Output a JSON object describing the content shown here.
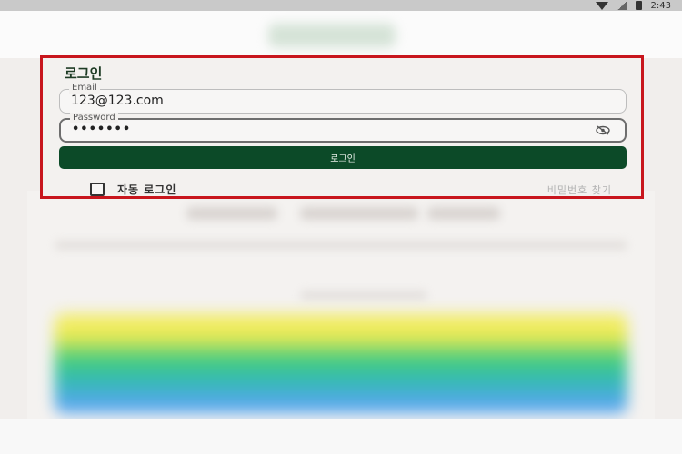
{
  "status_bar": {
    "time": "2:43",
    "icons": [
      "wifi-icon",
      "signal-icon",
      "battery-icon"
    ]
  },
  "login": {
    "title": "로그인",
    "email": {
      "label": "Email",
      "value": "123@123.com"
    },
    "password": {
      "label": "Password",
      "value": "•••••••",
      "toggle_icon": "eye-off-icon"
    },
    "submit_label": "로그인",
    "auto_login_label": "자동 로그인",
    "auto_login_checked": false,
    "find_password_label": "비밀번호 찾기"
  },
  "colors": {
    "accent": "#0c4a28",
    "highlight_border": "#c8161d",
    "background": "#f1eeec"
  }
}
